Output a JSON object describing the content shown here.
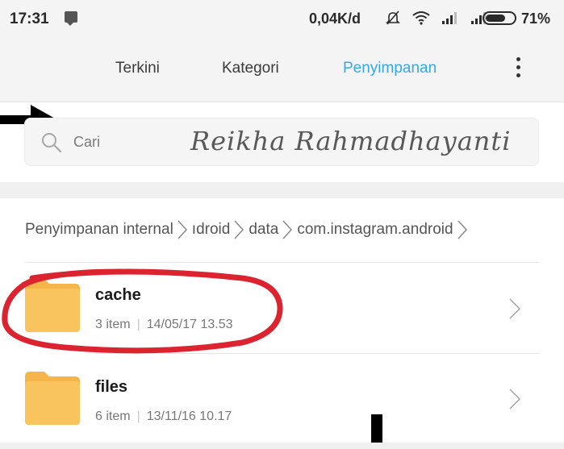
{
  "status_bar": {
    "time": "17:31",
    "net_speed": "0,04K/d",
    "battery_percent": "71%",
    "battery_level": 0.71,
    "icons": [
      "bbm-icon",
      "silent-icon",
      "wifi-icon",
      "signal-icon",
      "signal-icon",
      "battery-icon"
    ]
  },
  "tabs": [
    {
      "label": "Terkini",
      "active": false
    },
    {
      "label": "Kategori",
      "active": false
    },
    {
      "label": "Penyimpanan",
      "active": true
    }
  ],
  "search": {
    "placeholder": "Cari",
    "value": ""
  },
  "watermark": "Reikha Rahmadhayanti",
  "breadcrumb": [
    "Penyimpanan internal",
    "ıdroid",
    "data",
    "com.instagram.android"
  ],
  "files": [
    {
      "name": "cache",
      "count": "3 item",
      "date": "14/05/17 13.53"
    },
    {
      "name": "files",
      "count": "6 item",
      "date": "13/11/16 10.17"
    }
  ],
  "colors": {
    "accent": "#36a8e6",
    "folder": "#f7b84b",
    "annotation": "#dc2330",
    "top_background": "#f4f4f4"
  }
}
